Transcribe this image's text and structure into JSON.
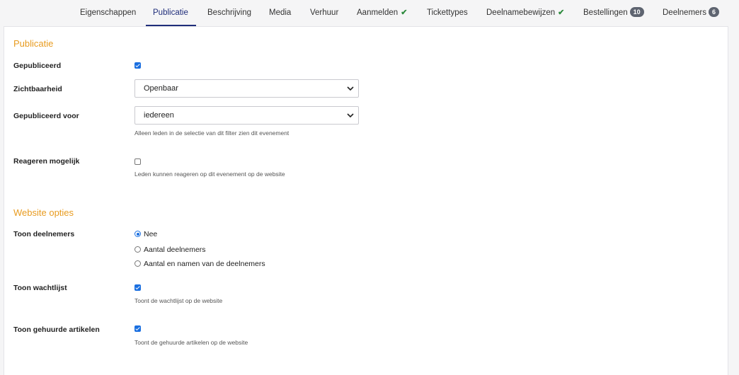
{
  "tabs": [
    {
      "label": "Eigenschappen"
    },
    {
      "label": "Publicatie",
      "active": true
    },
    {
      "label": "Beschrijving"
    },
    {
      "label": "Media"
    },
    {
      "label": "Verhuur"
    },
    {
      "label": "Aanmelden",
      "check": "✔"
    },
    {
      "label": "Tickettypes"
    },
    {
      "label": "Deelnamebewijzen",
      "check": "✔"
    },
    {
      "label": "Bestellingen",
      "badge": "10"
    },
    {
      "label": "Deelnemers",
      "badge": "6"
    }
  ],
  "publicatie": {
    "title": "Publicatie",
    "gepubliceerd": {
      "label": "Gepubliceerd",
      "checked": true
    },
    "zichtbaarheid": {
      "label": "Zichtbaarheid",
      "value": "Openbaar"
    },
    "gepubliceerd_voor": {
      "label": "Gepubliceerd voor",
      "value": "iedereen",
      "help": "Alleen leden in de selectie van dit filter zien dit evenement"
    },
    "reageren": {
      "label": "Reageren mogelijk",
      "checked": false,
      "help": "Leden kunnen reageren op dit evenement op de website"
    }
  },
  "website_opties": {
    "title": "Website opties",
    "toon_deelnemers": {
      "label": "Toon deelnemers",
      "options": [
        "Nee",
        "Aantal deelnemers",
        "Aantal en namen van de deelnemers"
      ],
      "selected": "Nee"
    },
    "toon_wachtlijst": {
      "label": "Toon wachtlijst",
      "checked": true,
      "help": "Toont de wachtlijst op de website"
    },
    "toon_gehuurde": {
      "label": "Toon gehuurde artikelen",
      "checked": true,
      "help": "Toont de gehuurde artikelen op de website"
    }
  },
  "colors": {
    "accent": "#e89b1f",
    "active_tab": "#1f2d7a",
    "checkbox": "#1a6fe0",
    "check_mark": "#2e8b3e",
    "badge": "#5e6470"
  }
}
